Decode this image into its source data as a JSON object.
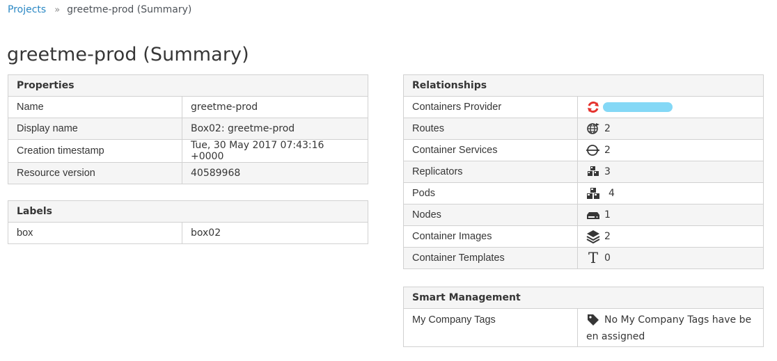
{
  "breadcrumb": {
    "projects": "Projects",
    "separator": "»",
    "current": "greetme-prod (Summary)"
  },
  "page_title": "greetme-prod (Summary)",
  "properties": {
    "header": "Properties",
    "rows": [
      {
        "label": "Name",
        "value": "greetme-prod"
      },
      {
        "label": "Display name",
        "value": "Box02: greetme-prod"
      },
      {
        "label": "Creation timestamp",
        "value": "Tue, 30 May 2017 07:43:16 +0000"
      },
      {
        "label": "Resource version",
        "value": "40589968"
      }
    ]
  },
  "labels": {
    "header": "Labels",
    "rows": [
      {
        "label": "box",
        "value": "box02"
      }
    ]
  },
  "relationships": {
    "header": "Relationships",
    "rows": [
      {
        "label": "Containers Provider",
        "icon": "openshift-provider-icon",
        "value": ""
      },
      {
        "label": "Routes",
        "icon": "route-globe-icon",
        "value": "2"
      },
      {
        "label": "Container Services",
        "icon": "service-icon",
        "value": "2"
      },
      {
        "label": "Replicators",
        "icon": "replicator-cubes-icon",
        "value": "3"
      },
      {
        "label": "Pods",
        "icon": "pod-cubes-icon",
        "value": "4"
      },
      {
        "label": "Nodes",
        "icon": "node-server-icon",
        "value": "1"
      },
      {
        "label": "Container Images",
        "icon": "image-layers-icon",
        "value": "2"
      },
      {
        "label": "Container Templates",
        "icon": "template-t-icon",
        "value": "0"
      }
    ]
  },
  "smart_management": {
    "header": "Smart Management",
    "tags_label": "My Company Tags",
    "tags_value": "No My Company Tags have be en assigned",
    "tags_line1": "No My Company Tags have be",
    "tags_line2": "en assigned",
    "icon": "tag-icon"
  },
  "colors": {
    "link": "#2b88c4",
    "border": "#d1d1d1",
    "header_bg": "#f5f5f5",
    "provider_red": "#e5322d",
    "redaction": "#84d8f6"
  }
}
